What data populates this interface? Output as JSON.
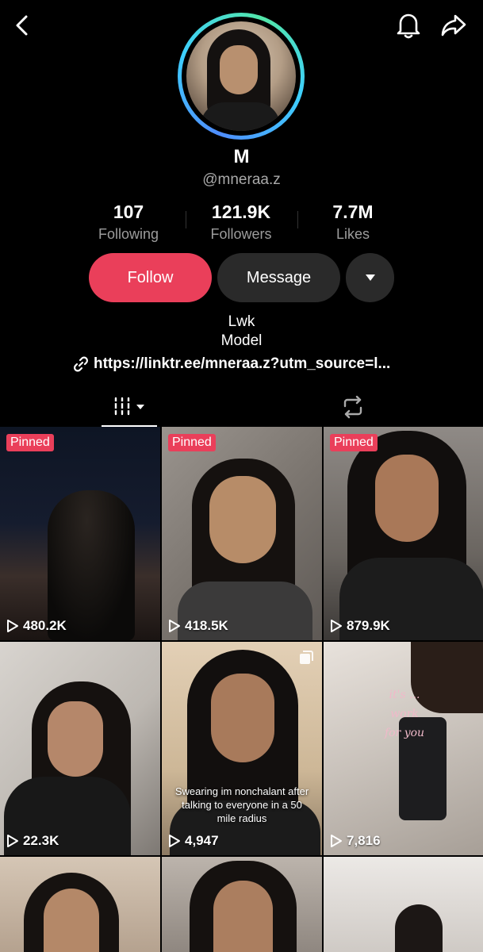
{
  "profile": {
    "name": "M",
    "handle": "@mneraa.z",
    "stats": {
      "following": {
        "value": "107",
        "label": "Following"
      },
      "followers": {
        "value": "121.9K",
        "label": "Followers"
      },
      "likes": {
        "value": "7.7M",
        "label": "Likes"
      }
    },
    "bio_line1": "Lwk",
    "bio_line2": "Model",
    "link": "https://linktr.ee/mneraa.z?utm_source=l...",
    "ring_colors": [
      "#4f8dff",
      "#3ecfff",
      "#52e6a8"
    ]
  },
  "actions": {
    "follow_label": "Follow",
    "message_label": "Message",
    "follow_color": "#ea3f5a"
  },
  "icons": {
    "back": "chevron-left-icon",
    "bell": "bell-icon",
    "share": "share-arrow-icon",
    "more": "caret-down-icon",
    "link": "link-icon",
    "videos_tab": "grid-columns-icon",
    "reposts_tab": "repost-icon"
  },
  "videos": [
    {
      "pinned": "Pinned",
      "views": "480.2K"
    },
    {
      "pinned": "Pinned",
      "views": "418.5K"
    },
    {
      "pinned": "Pinned",
      "views": "879.9K"
    },
    {
      "views": "22.3K"
    },
    {
      "views": "4,947",
      "caption": "Swearing im nonchalant after talking to everyone in a 50 mile radius"
    },
    {
      "views": "7,816",
      "overlay": "it's ... work for you"
    }
  ]
}
